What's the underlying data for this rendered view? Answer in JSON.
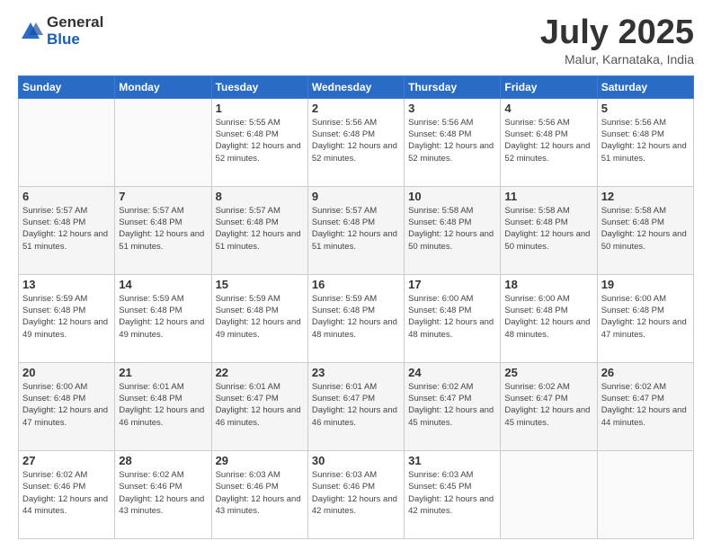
{
  "logo": {
    "general": "General",
    "blue": "Blue"
  },
  "header": {
    "month": "July 2025",
    "location": "Malur, Karnataka, India"
  },
  "weekdays": [
    "Sunday",
    "Monday",
    "Tuesday",
    "Wednesday",
    "Thursday",
    "Friday",
    "Saturday"
  ],
  "weeks": [
    [
      {
        "day": "",
        "info": ""
      },
      {
        "day": "",
        "info": ""
      },
      {
        "day": "1",
        "info": "Sunrise: 5:55 AM\nSunset: 6:48 PM\nDaylight: 12 hours and 52 minutes."
      },
      {
        "day": "2",
        "info": "Sunrise: 5:56 AM\nSunset: 6:48 PM\nDaylight: 12 hours and 52 minutes."
      },
      {
        "day": "3",
        "info": "Sunrise: 5:56 AM\nSunset: 6:48 PM\nDaylight: 12 hours and 52 minutes."
      },
      {
        "day": "4",
        "info": "Sunrise: 5:56 AM\nSunset: 6:48 PM\nDaylight: 12 hours and 52 minutes."
      },
      {
        "day": "5",
        "info": "Sunrise: 5:56 AM\nSunset: 6:48 PM\nDaylight: 12 hours and 51 minutes."
      }
    ],
    [
      {
        "day": "6",
        "info": "Sunrise: 5:57 AM\nSunset: 6:48 PM\nDaylight: 12 hours and 51 minutes."
      },
      {
        "day": "7",
        "info": "Sunrise: 5:57 AM\nSunset: 6:48 PM\nDaylight: 12 hours and 51 minutes."
      },
      {
        "day": "8",
        "info": "Sunrise: 5:57 AM\nSunset: 6:48 PM\nDaylight: 12 hours and 51 minutes."
      },
      {
        "day": "9",
        "info": "Sunrise: 5:57 AM\nSunset: 6:48 PM\nDaylight: 12 hours and 51 minutes."
      },
      {
        "day": "10",
        "info": "Sunrise: 5:58 AM\nSunset: 6:48 PM\nDaylight: 12 hours and 50 minutes."
      },
      {
        "day": "11",
        "info": "Sunrise: 5:58 AM\nSunset: 6:48 PM\nDaylight: 12 hours and 50 minutes."
      },
      {
        "day": "12",
        "info": "Sunrise: 5:58 AM\nSunset: 6:48 PM\nDaylight: 12 hours and 50 minutes."
      }
    ],
    [
      {
        "day": "13",
        "info": "Sunrise: 5:59 AM\nSunset: 6:48 PM\nDaylight: 12 hours and 49 minutes."
      },
      {
        "day": "14",
        "info": "Sunrise: 5:59 AM\nSunset: 6:48 PM\nDaylight: 12 hours and 49 minutes."
      },
      {
        "day": "15",
        "info": "Sunrise: 5:59 AM\nSunset: 6:48 PM\nDaylight: 12 hours and 49 minutes."
      },
      {
        "day": "16",
        "info": "Sunrise: 5:59 AM\nSunset: 6:48 PM\nDaylight: 12 hours and 48 minutes."
      },
      {
        "day": "17",
        "info": "Sunrise: 6:00 AM\nSunset: 6:48 PM\nDaylight: 12 hours and 48 minutes."
      },
      {
        "day": "18",
        "info": "Sunrise: 6:00 AM\nSunset: 6:48 PM\nDaylight: 12 hours and 48 minutes."
      },
      {
        "day": "19",
        "info": "Sunrise: 6:00 AM\nSunset: 6:48 PM\nDaylight: 12 hours and 47 minutes."
      }
    ],
    [
      {
        "day": "20",
        "info": "Sunrise: 6:00 AM\nSunset: 6:48 PM\nDaylight: 12 hours and 47 minutes."
      },
      {
        "day": "21",
        "info": "Sunrise: 6:01 AM\nSunset: 6:48 PM\nDaylight: 12 hours and 46 minutes."
      },
      {
        "day": "22",
        "info": "Sunrise: 6:01 AM\nSunset: 6:47 PM\nDaylight: 12 hours and 46 minutes."
      },
      {
        "day": "23",
        "info": "Sunrise: 6:01 AM\nSunset: 6:47 PM\nDaylight: 12 hours and 46 minutes."
      },
      {
        "day": "24",
        "info": "Sunrise: 6:02 AM\nSunset: 6:47 PM\nDaylight: 12 hours and 45 minutes."
      },
      {
        "day": "25",
        "info": "Sunrise: 6:02 AM\nSunset: 6:47 PM\nDaylight: 12 hours and 45 minutes."
      },
      {
        "day": "26",
        "info": "Sunrise: 6:02 AM\nSunset: 6:47 PM\nDaylight: 12 hours and 44 minutes."
      }
    ],
    [
      {
        "day": "27",
        "info": "Sunrise: 6:02 AM\nSunset: 6:46 PM\nDaylight: 12 hours and 44 minutes."
      },
      {
        "day": "28",
        "info": "Sunrise: 6:02 AM\nSunset: 6:46 PM\nDaylight: 12 hours and 43 minutes."
      },
      {
        "day": "29",
        "info": "Sunrise: 6:03 AM\nSunset: 6:46 PM\nDaylight: 12 hours and 43 minutes."
      },
      {
        "day": "30",
        "info": "Sunrise: 6:03 AM\nSunset: 6:46 PM\nDaylight: 12 hours and 42 minutes."
      },
      {
        "day": "31",
        "info": "Sunrise: 6:03 AM\nSunset: 6:45 PM\nDaylight: 12 hours and 42 minutes."
      },
      {
        "day": "",
        "info": ""
      },
      {
        "day": "",
        "info": ""
      }
    ]
  ]
}
